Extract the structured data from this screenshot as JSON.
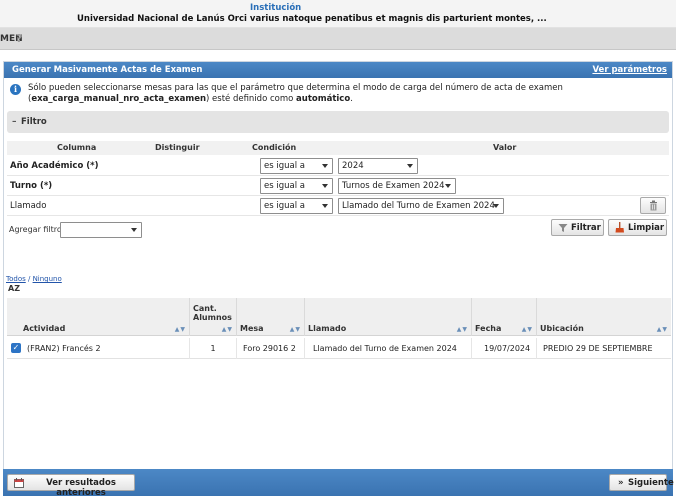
{
  "header": {
    "institucion_label": "Institución",
    "institucion_name": "Universidad Nacional de Lanús Orci varius natoque penatibus et magnis dis parturient montes, ...",
    "page_title": "MEN",
    "help_icon": "question-icon"
  },
  "panel": {
    "title": "Generar Masivamente Actas de Examen",
    "ver_parametros": "Ver parámetros",
    "info_icon": "info-icon",
    "info_pre": "Sólo pueden seleccionarse mesas para las que el parámetro que determina el modo de carga del número de acta de examen (",
    "info_param": "exa_carga_manual_nro_acta_examen",
    "info_mid": ") esté definido como ",
    "info_value": "automático",
    "info_end": "."
  },
  "filtro": {
    "toggle": "–",
    "label": "Filtro",
    "headers": {
      "columna": "Columna",
      "distinguir": "Distinguir",
      "condicion": "Condición",
      "valor": "Valor"
    },
    "rows": [
      {
        "label": "Año Académico (*)",
        "condicion": "es igual a",
        "valor": "2024"
      },
      {
        "label": "Turno (*)",
        "condicion": "es igual a",
        "valor": "Turnos de Examen 2024"
      },
      {
        "label": "Llamado",
        "condicion": "es igual a",
        "valor": "Llamado del Turno de Examen 2024"
      }
    ],
    "agregar_label": "Agregar filtro",
    "agregar_value": "",
    "filtrar_label": "Filtrar",
    "limpiar_label": "Limpiar"
  },
  "selection": {
    "todos": "Todos",
    "sep": " / ",
    "ninguno": "Ninguno",
    "az": "AZ"
  },
  "grid": {
    "columns": {
      "actividad": "Actividad",
      "cant_alumnos": "Cant. Alumnos",
      "mesa": "Mesa",
      "llamado": "Llamado",
      "fecha": "Fecha",
      "ubicacion": "Ubicación"
    },
    "rows": [
      {
        "checked": true,
        "actividad": "(FRAN2) Francés 2",
        "cant_alumnos": "1",
        "mesa": "Foro 29016 2",
        "llamado": "Llamado del Turno de Examen 2024",
        "fecha": "19/07/2024",
        "ubicacion": "PREDIO 29 DE SEPTIEMBRE"
      }
    ]
  },
  "footer": {
    "ver_resultados": "Ver resultados anteriores",
    "siguiente": "Siguiente",
    "siguiente_arrow": "»"
  }
}
